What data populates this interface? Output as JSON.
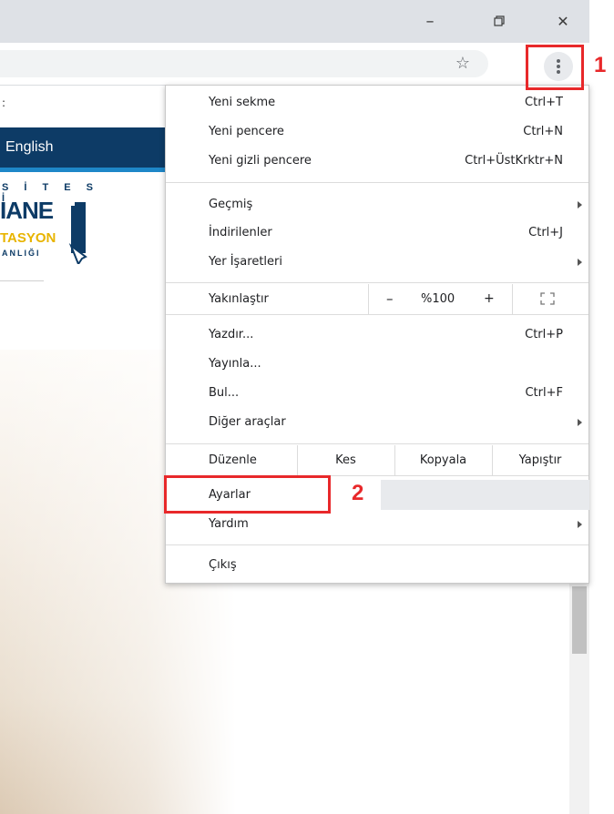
{
  "window": {
    "minimize_glyph": "–",
    "restore_glyph": "❐",
    "close_glyph": "✕"
  },
  "toolbar": {
    "bookmark_star_icon": "star-icon",
    "menu_icon": "three-dot-menu-icon"
  },
  "page": {
    "top_text": ":",
    "language_link": "English",
    "logo": {
      "line1": "S İ T E S İ",
      "line2": "IANE",
      "line3": "TASYON",
      "line4": "ANLIĞI"
    }
  },
  "menu": {
    "new_tab": {
      "label": "Yeni sekme",
      "shortcut": "Ctrl+T"
    },
    "new_window": {
      "label": "Yeni pencere",
      "shortcut": "Ctrl+N"
    },
    "incognito": {
      "label": "Yeni gizli pencere",
      "shortcut": "Ctrl+ÜstKrktr+N"
    },
    "history": {
      "label": "Geçmiş"
    },
    "downloads": {
      "label": "İndirilenler",
      "shortcut": "Ctrl+J"
    },
    "bookmarks": {
      "label": "Yer İşaretleri"
    },
    "zoom": {
      "label": "Yakınlaştır",
      "minus": "–",
      "value": "%100",
      "plus": "+"
    },
    "print": {
      "label": "Yazdır...",
      "shortcut": "Ctrl+P"
    },
    "cast": {
      "label": "Yayınla..."
    },
    "find": {
      "label": "Bul...",
      "shortcut": "Ctrl+F"
    },
    "more_tools": {
      "label": "Diğer araçlar"
    },
    "edit": {
      "label": "Düzenle",
      "cut": "Kes",
      "copy": "Kopyala",
      "paste": "Yapıştır"
    },
    "settings": {
      "label": "Ayarlar"
    },
    "help": {
      "label": "Yardım"
    },
    "exit": {
      "label": "Çıkış"
    }
  },
  "annotations": {
    "step1": "1",
    "step2": "2",
    "color": "#e8282a"
  }
}
